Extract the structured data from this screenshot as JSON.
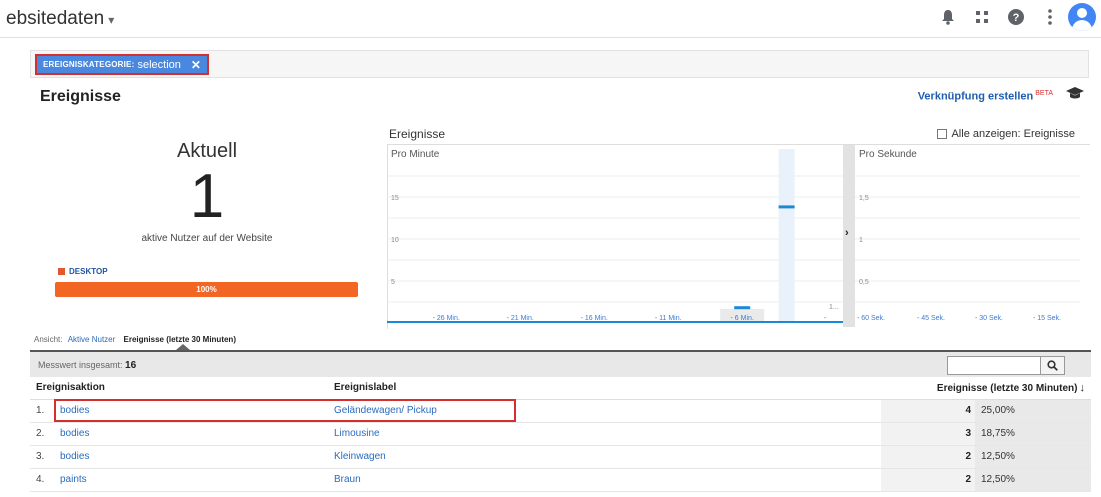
{
  "header": {
    "title": "ebsitedaten",
    "title_caret": "▾",
    "icons": [
      "bell-icon",
      "apps-grid-icon",
      "help-icon",
      "more-vert-icon",
      "account-avatar-icon"
    ]
  },
  "filter": {
    "key": "EREIGNISKATEGORIE:",
    "value": "selection",
    "remove": "✕"
  },
  "section": {
    "title": "Ereignisse",
    "link": "Verknüpfung erstellen",
    "link_badge": "BETA",
    "icon": "graduation-cap-icon"
  },
  "realtime": {
    "label": "Aktuell",
    "value": "1",
    "sub": "aktive Nutzer auf der Website",
    "devices": [
      {
        "name": "DESKTOP",
        "share_text": "100%",
        "share": 1.0,
        "color": "#f26522"
      }
    ]
  },
  "charts": {
    "title": "Ereignisse",
    "show_all_label": "Alle anzeigen: Ereignisse",
    "show_all_checked": false,
    "expand_arrow": "›"
  },
  "chart_data": [
    {
      "type": "bar",
      "title": "Pro Minute",
      "y_ticks": [
        "15",
        "10",
        "5"
      ],
      "ylim": [
        0,
        20
      ],
      "x_ticks": [
        "- 26 Min.",
        "- 21 Min.",
        "- 16 Min.",
        "- 11 Min.",
        "- 6 Min.",
        "-"
      ],
      "x_range": [
        -30,
        0
      ],
      "highlight_minute": -6,
      "series": [
        {
          "x": -6,
          "y": 2
        },
        {
          "x": -3,
          "y": 14
        }
      ],
      "annotation": "1...",
      "bar_color": "#1e88d8"
    },
    {
      "type": "bar",
      "title": "Pro Sekunde",
      "y_ticks": [
        "1,5",
        "1",
        "0,5"
      ],
      "ylim": [
        0,
        2
      ],
      "x_ticks": [
        "- 60 Sek.",
        "- 45 Sek.",
        "- 30 Sek.",
        "- 15 Sek."
      ],
      "series": []
    }
  ],
  "view": {
    "prefix": "Ansicht:",
    "options": [
      "Aktive Nutzer",
      "Ereignisse (letzte 30 Minuten)"
    ],
    "active": 1
  },
  "table": {
    "total_label": "Messwert insgesamt:",
    "total_value": "16",
    "search_placeholder": "",
    "columns": [
      "Ereignisaktion",
      "Ereignislabel",
      "Ereignisse (letzte 30 Minuten)"
    ],
    "sort_indicator": "↓",
    "rows": [
      {
        "index": "1.",
        "action": "bodies",
        "label": "Geländewagen/ Pickup",
        "count": "4",
        "pct": "25,00%"
      },
      {
        "index": "2.",
        "action": "bodies",
        "label": "Limousine",
        "count": "3",
        "pct": "18,75%"
      },
      {
        "index": "3.",
        "action": "bodies",
        "label": "Kleinwagen",
        "count": "2",
        "pct": "12,50%"
      },
      {
        "index": "4.",
        "action": "paints",
        "label": "Braun",
        "count": "2",
        "pct": "12,50%"
      }
    ]
  },
  "colors": {
    "accent_blue": "#4a88e0",
    "link_blue": "#2a6bbf",
    "highlight_red": "#d32f2f",
    "device_orange": "#f26522"
  }
}
